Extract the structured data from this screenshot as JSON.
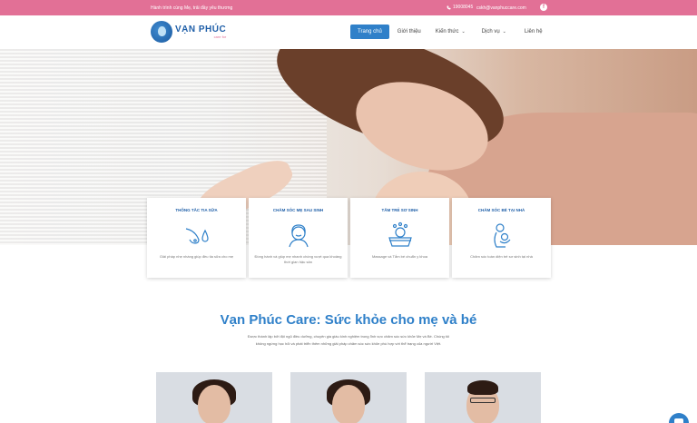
{
  "topbar": {
    "tagline": "Hành trình cùng Mẹ, trải đầy yêu thương",
    "phone": "19008045",
    "email": "cskh@vanphuccare.com",
    "facebook_icon": "facebook-icon"
  },
  "logo": {
    "name": "VẠN PHÚC",
    "sub": "care for"
  },
  "nav": {
    "home": "Trang chủ",
    "about": "Giới thiệu",
    "knowledge": "Kiến thức",
    "services": "Dịch vụ",
    "contact": "Liên hệ"
  },
  "cards": [
    {
      "title": "THÔNG TẮC TIA SỮA",
      "desc": "Giải pháp nhẹ nhàng giúp đều tia sữa cho mẹ",
      "icon": "breast-milk-icon"
    },
    {
      "title": "CHĂM SÓC MẸ SAU SINH",
      "desc": "Đồng hành và giúp mẹ nhanh chóng vượt qua khoảng thời gian hậu sản",
      "icon": "mother-care-icon"
    },
    {
      "title": "TẮM TRẺ SƠ SINH",
      "desc": "Massage và Tắm bé chuẩn y khoa",
      "icon": "baby-bath-icon"
    },
    {
      "title": "CHĂM SÓC BÉ TẠI NHÀ",
      "desc": "Chăm sóc toàn diện trẻ sơ sinh tại nhà",
      "icon": "baby-care-icon"
    }
  ],
  "section": {
    "title": "Vạn Phúc Care: Sức khỏe cho mẹ và bé",
    "text": "Được thành lập bởi đội ngũ điều dưỡng, chuyên gia giàu kinh nghiệm trong lĩnh vực chăm sóc sức khỏe Mẹ và Bé. Chúng tôi không ngừng học hỏi và phát triển thêm những giải pháp chăm sóc sức khỏe phù hợp với thể trạng của người Việt."
  },
  "colors": {
    "topbar": "#e27096",
    "brand_blue": "#2f80c9",
    "logo_blue": "#1f5fa8"
  }
}
